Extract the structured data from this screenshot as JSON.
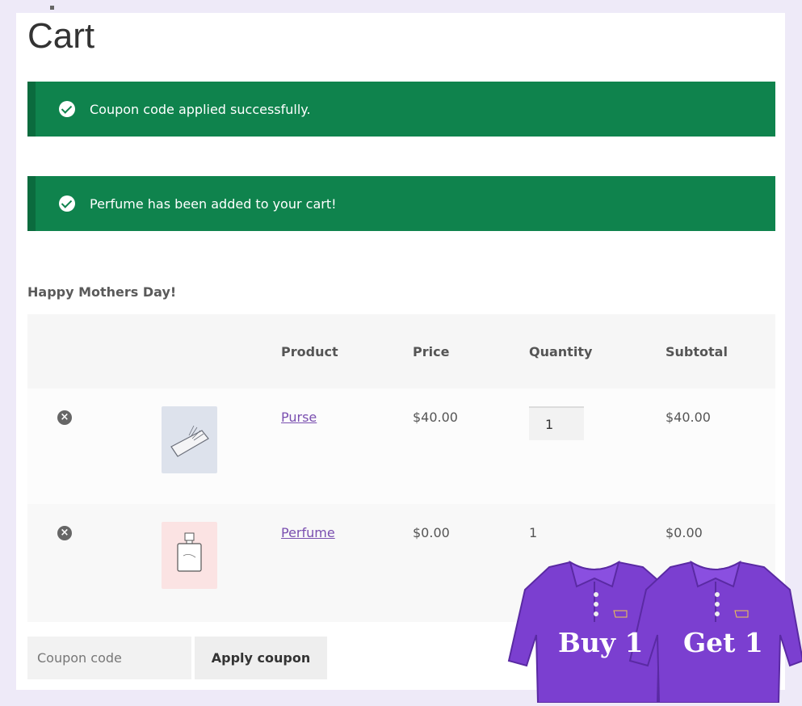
{
  "page": {
    "title": "Cart"
  },
  "notices": [
    {
      "text": "Coupon code applied successfully."
    },
    {
      "text": "Perfume has been added to your cart!"
    }
  ],
  "cart": {
    "heading": "Happy Mothers Day!",
    "columns": {
      "product": "Product",
      "price": "Price",
      "quantity": "Quantity",
      "subtotal": "Subtotal"
    },
    "remove_symbol": "×",
    "items": [
      {
        "product": "Purse",
        "price": "$40.00",
        "quantity": "1",
        "subtotal": "$40.00",
        "quantity_editable": true
      },
      {
        "product": "Perfume",
        "price": "$0.00",
        "quantity": "1",
        "subtotal": "$0.00",
        "quantity_editable": false
      }
    ]
  },
  "coupon": {
    "placeholder": "Coupon code",
    "button": "Apply coupon"
  },
  "promo": {
    "left": "Buy 1",
    "right": "Get 1",
    "shirt_color": "#7b3fd0"
  },
  "colors": {
    "notice_bg": "#0f834d",
    "link": "#7a4fb0"
  }
}
